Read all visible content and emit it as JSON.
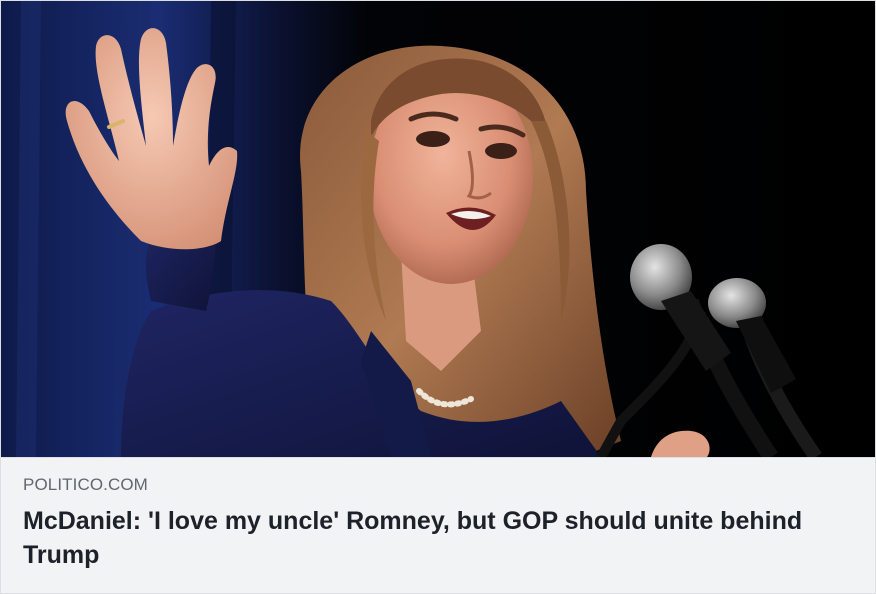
{
  "link_card": {
    "domain": "POLITICO.COM",
    "headline": "McDaniel: 'I love my uncle' Romney, but GOP should unite behind Trump",
    "image": {
      "subject": "woman speaking at microphones"
    }
  },
  "colors": {
    "caption_background": "#f2f3f5",
    "domain_text": "#606770",
    "headline_text": "#1d2129",
    "border": "#dddfe2"
  }
}
